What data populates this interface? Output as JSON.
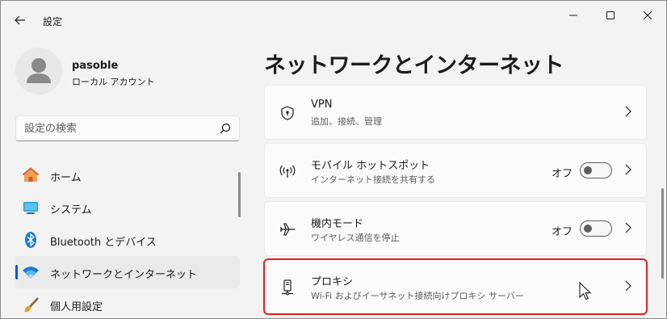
{
  "app": {
    "title": "設定"
  },
  "profile": {
    "name": "pasoble",
    "account": "ローカル アカウント"
  },
  "search": {
    "placeholder": "設定の検索"
  },
  "nav": {
    "items": [
      {
        "label": "ホーム",
        "icon": "home-icon"
      },
      {
        "label": "システム",
        "icon": "system-icon"
      },
      {
        "label": "Bluetooth とデバイス",
        "icon": "bluetooth-icon"
      },
      {
        "label": "ネットワークとインターネット",
        "icon": "wifi-icon",
        "active": true
      },
      {
        "label": "個人用設定",
        "icon": "brush-icon"
      }
    ]
  },
  "page": {
    "title": "ネットワークとインターネット"
  },
  "cards": {
    "vpn": {
      "title": "VPN",
      "subtitle": "追加、接続、管理",
      "icon": "shield-icon"
    },
    "hotspot": {
      "title": "モバイル ホットスポット",
      "subtitle": "インターネット接続を共有する",
      "state": "オフ",
      "icon": "hotspot-icon"
    },
    "airplane": {
      "title": "機内モード",
      "subtitle": "ワイヤレス通信を停止",
      "state": "オフ",
      "icon": "airplane-icon"
    },
    "proxy": {
      "title": "プロキシ",
      "subtitle": "Wi-Fi およびイーサネット接続向けプロキシ サーバー",
      "icon": "proxy-icon"
    }
  },
  "colors": {
    "accent": "#005fb8",
    "highlight": "#e02020"
  }
}
